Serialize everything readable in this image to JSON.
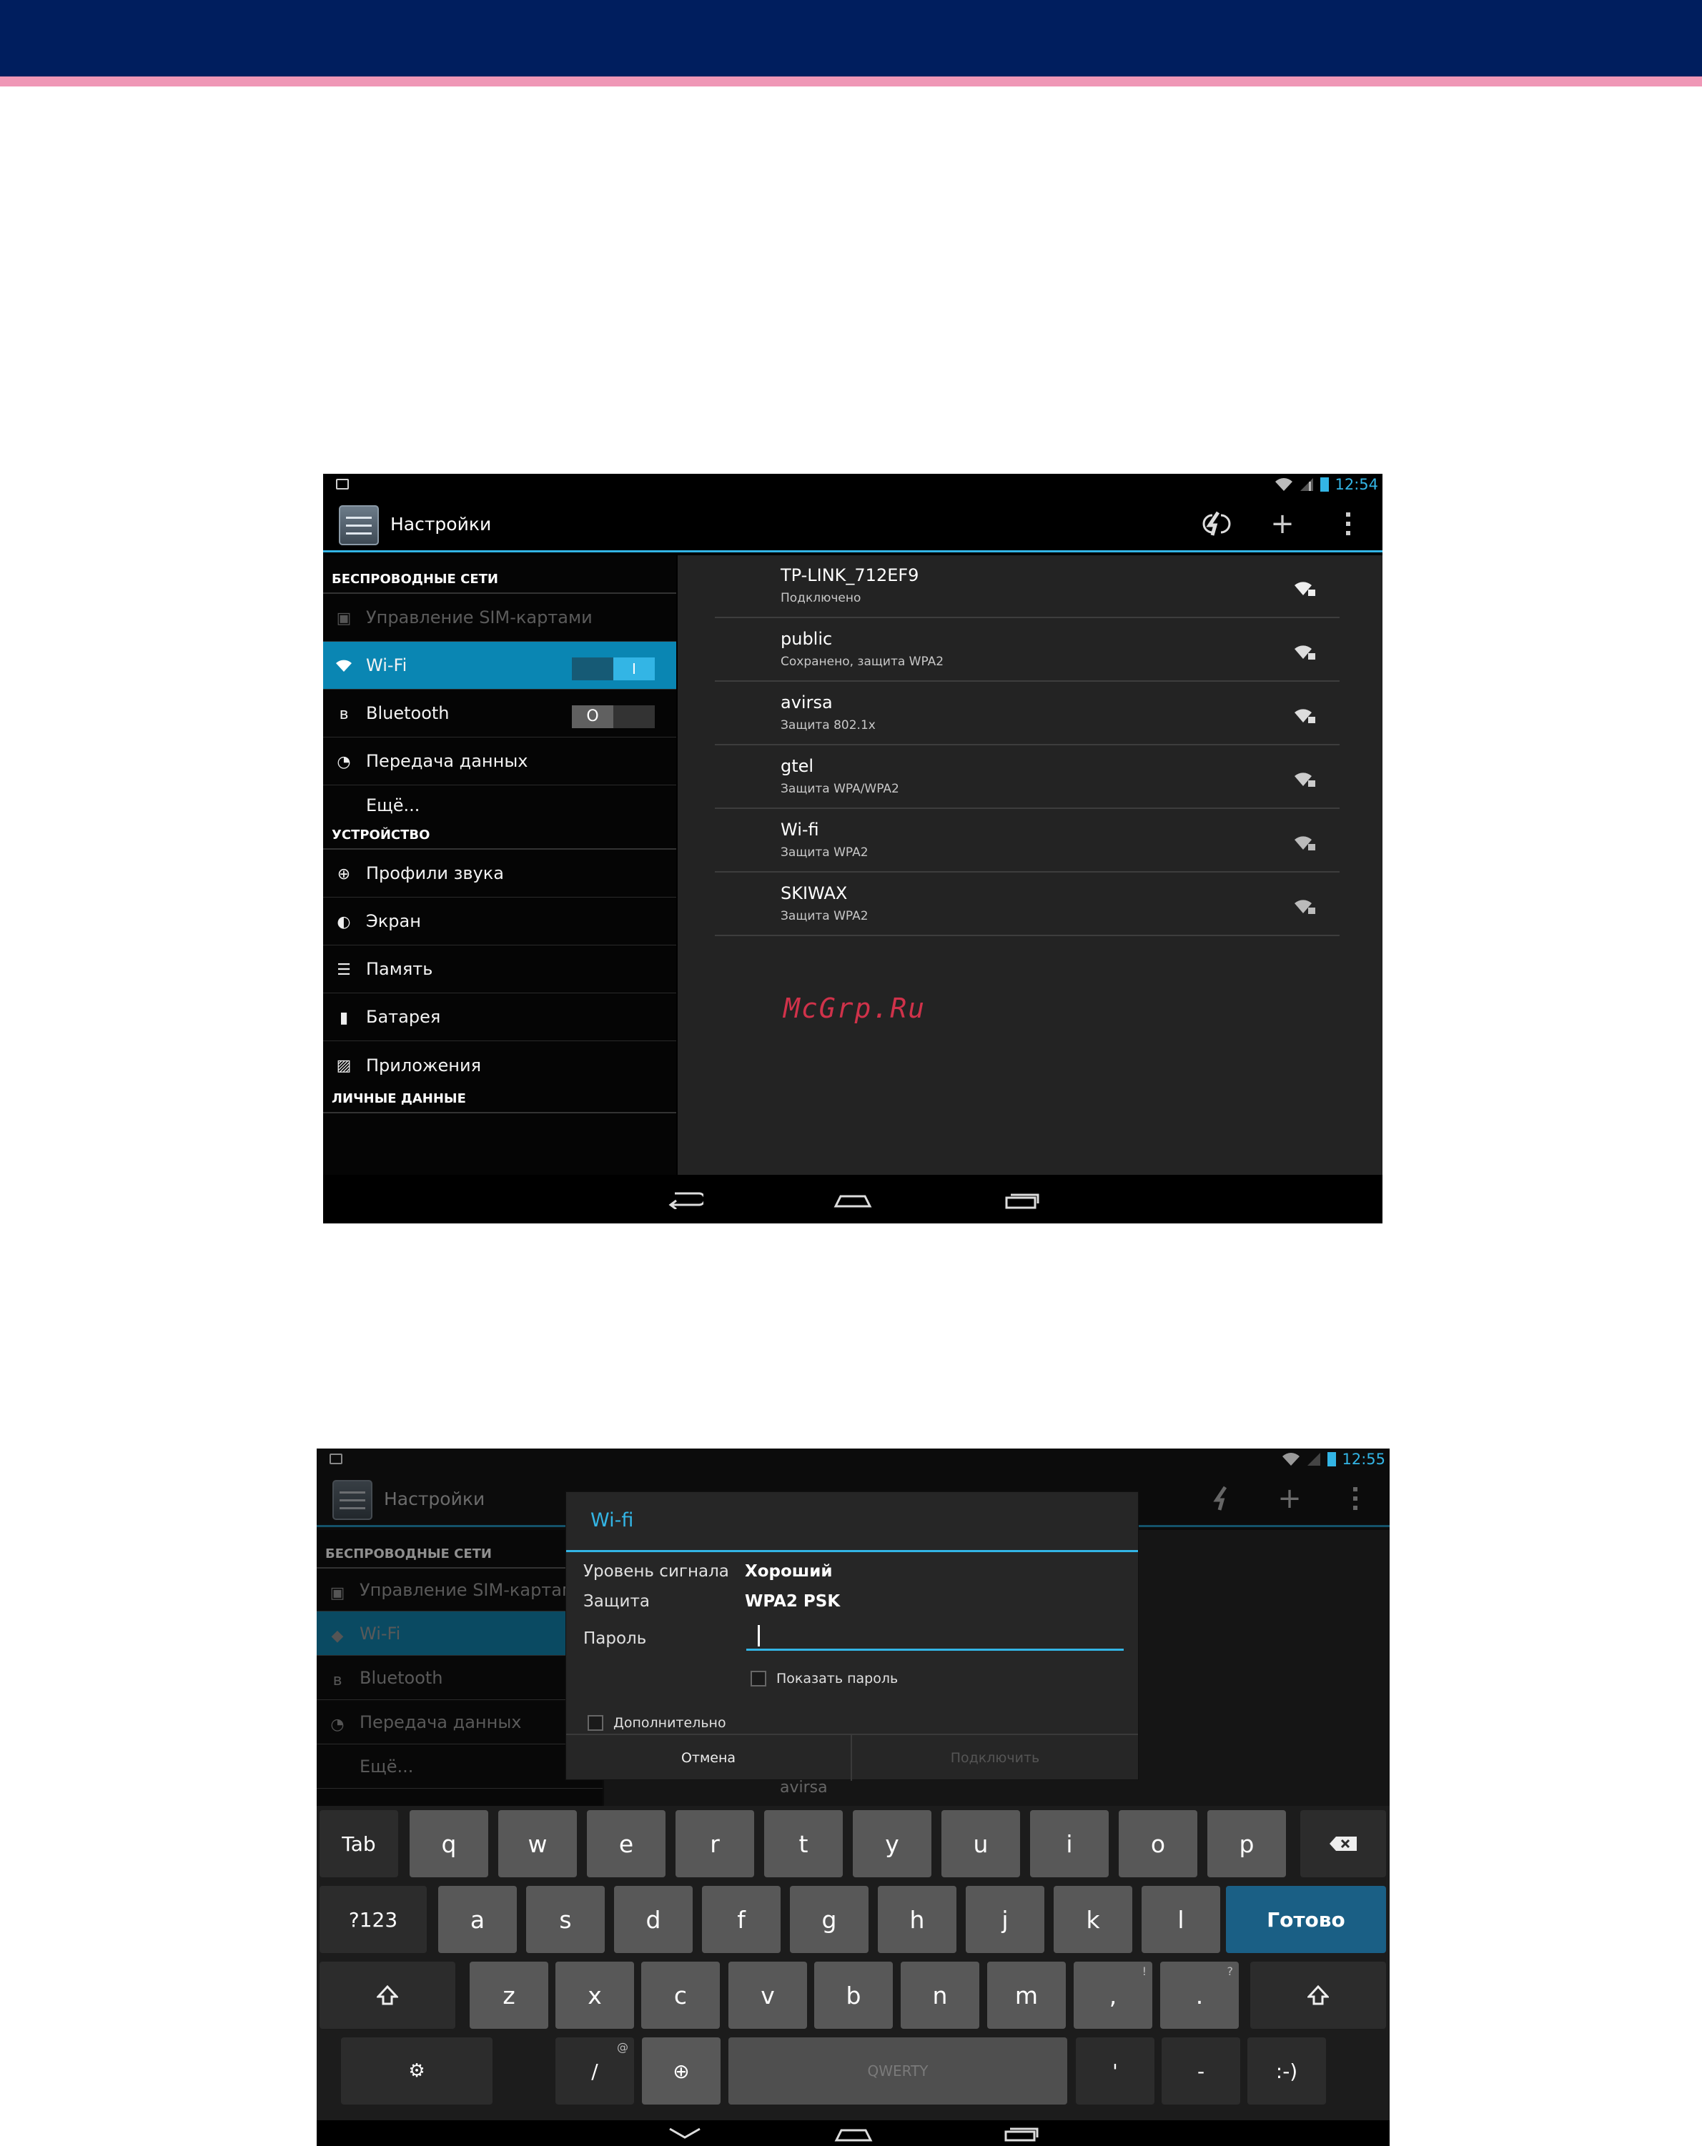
{
  "colors": {
    "header": "#001e5e",
    "stripe": "#ef97b6",
    "accent": "#33b5e5",
    "watermark": "#d0324a"
  },
  "s1": {
    "status_time": "12:54",
    "app_title": "Настройки",
    "actions": [
      "sync-icon",
      "add-icon",
      "overflow-menu-icon"
    ],
    "sections": {
      "wireless": "БЕСПРОВОДНЫЕ СЕТИ",
      "device": "УСТРОЙСТВО",
      "personal": "ЛИЧНЫЕ ДАННЫЕ"
    },
    "items": {
      "sim": "Управление SIM-картами",
      "wifi": "Wi-Fi",
      "wifi_toggle": "I",
      "bt": "Bluetooth",
      "bt_toggle": "O",
      "data": "Передача данных",
      "more": "Ещё...",
      "sound": "Профили звука",
      "screen": "Экран",
      "memory": "Память",
      "battery": "Батарея",
      "apps": "Приложения"
    },
    "networks": [
      {
        "ssid": "TP-LINK_712EF9",
        "status": "Подключено"
      },
      {
        "ssid": "public",
        "status": "Сохранено, защита WPA2"
      },
      {
        "ssid": "avirsa",
        "status": "Защита 802.1x"
      },
      {
        "ssid": "gtel",
        "status": "Защита WPA/WPA2"
      },
      {
        "ssid": "Wi-fi",
        "status": "Защита WPA2"
      },
      {
        "ssid": "SKIWAX",
        "status": "Защита WPA2"
      }
    ],
    "watermark": "McGrp.Ru"
  },
  "s2": {
    "status_time": "12:55",
    "app_title": "Настройки",
    "sections": {
      "wireless": "БЕСПРОВОДНЫЕ СЕТИ"
    },
    "items": {
      "sim": "Управление SIM-картами",
      "wifi": "Wi-Fi",
      "bt": "Bluetooth",
      "data": "Передача данных",
      "more": "Ещё..."
    },
    "peek_network": "avirsa",
    "dialog": {
      "title": "Wi-fi",
      "signal_label": "Уровень сигнала",
      "signal_value": "Хороший",
      "security_label": "Защита",
      "security_value": "WPA2 PSK",
      "password_label": "Пароль",
      "show_password": "Показать пароль",
      "advanced": "Дополнительно",
      "cancel": "Отмена",
      "connect": "Подключить"
    },
    "keyboard": {
      "row1": [
        "Tab",
        "q",
        "w",
        "e",
        "r",
        "t",
        "y",
        "u",
        "i",
        "o",
        "p"
      ],
      "row2": [
        "?123",
        "a",
        "s",
        "d",
        "f",
        "g",
        "h",
        "j",
        "k",
        "l"
      ],
      "done": "Готово",
      "row3": [
        "z",
        "x",
        "c",
        "v",
        "b",
        "n",
        "m",
        ",",
        "."
      ],
      "row3_hints": [
        "!",
        "?"
      ],
      "slash": "/",
      "slash_hint": "@",
      "space": "QWERTY",
      "apostrophe": "'",
      "dash": "-",
      "smile": ":-)"
    }
  }
}
